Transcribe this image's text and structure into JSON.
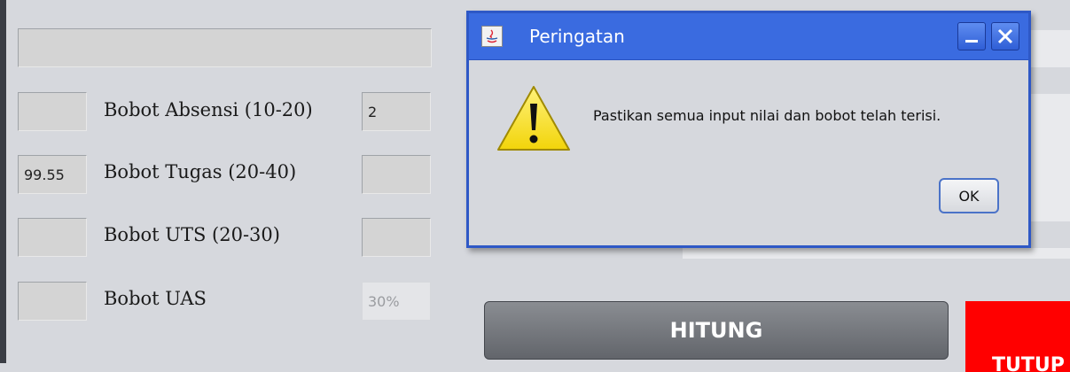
{
  "form": {
    "top_field_value": "",
    "rows": [
      {
        "score_value": "",
        "label": "Bobot Absensi (10-20)",
        "weight_value": "2"
      },
      {
        "score_value": "99.55",
        "label": "Bobot Tugas (20-40)",
        "weight_value": ""
      },
      {
        "score_value": "",
        "label": "Bobot UTS (20-30)",
        "weight_value": ""
      },
      {
        "score_value": "",
        "label": "Bobot UAS",
        "weight_value": "30%"
      }
    ]
  },
  "buttons": {
    "hitung_label": "HITUNG",
    "tutup_label": "TUTUP"
  },
  "dialog": {
    "title": "Peringatan",
    "icon": "warning-icon",
    "message": "Pastikan semua input nilai dan bobot telah terisi.",
    "ok_label": "OK",
    "minimize_icon": "minimize-icon",
    "close_icon": "close-icon"
  },
  "colors": {
    "dialog_titlebar": "#3a6be0",
    "hitung_button": "#6f7277",
    "tutup_button": "#ff0000",
    "warning_fill": "#f7e017"
  }
}
